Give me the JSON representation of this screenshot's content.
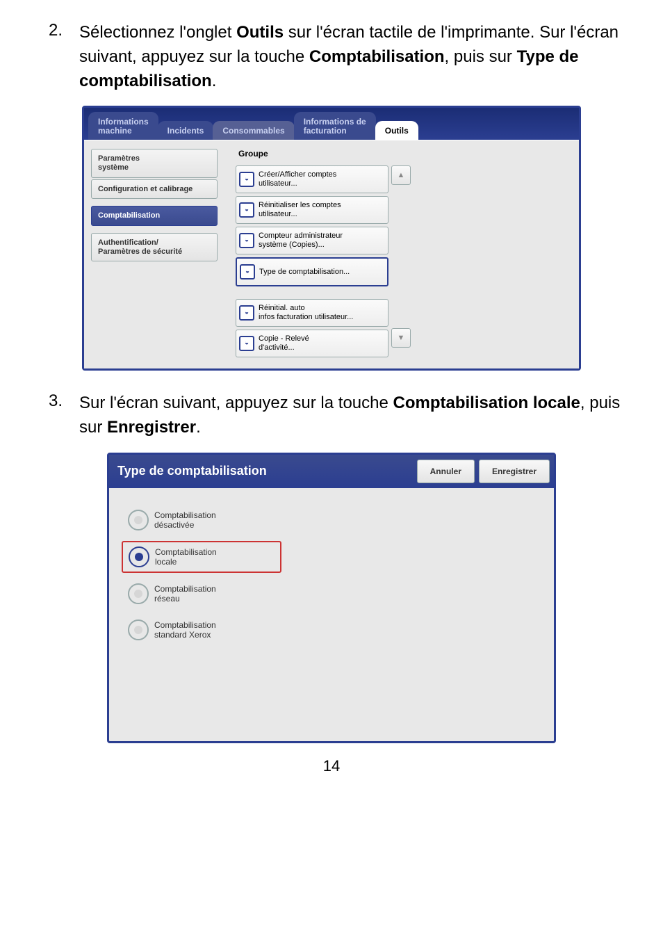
{
  "step2_num": "2.",
  "step2_pre": "Sélectionnez l'onglet ",
  "step2_b1": "Outils",
  "step2_mid1": " sur l'écran tactile de l'imprimante. Sur l'écran suivant, appuyez sur la touche ",
  "step2_b2": "Comptabilisation",
  "step2_mid2": ", puis sur ",
  "step2_b3": "Type de comptabilisation",
  "step2_end": ".",
  "tabs": {
    "t1": "Informations\nmachine",
    "t2": "Incidents",
    "t3": "Consommables",
    "t4": "Informations de\nfacturation",
    "t5": "Outils"
  },
  "side": {
    "s1": "Paramètres\nsystème",
    "s2": "Configuration et calibrage",
    "s3": "Comptabilisation",
    "s4": "Authentification/\nParamètres de sécurité"
  },
  "group_label": "Groupe",
  "list": {
    "i1": "Créer/Afficher comptes\nutilisateur...",
    "i2": "Réinitialiser les comptes\nutilisateur...",
    "i3": "Compteur administrateur\nsystème (Copies)...",
    "i4": "Type de comptabilisation...",
    "i5": "Réinitial. auto\ninfos facturation utilisateur...",
    "i6": "Copie - Relevé\nd'activité..."
  },
  "step3_num": "3.",
  "step3_pre": "Sur l'écran suivant, appuyez sur la touche ",
  "step3_b1": "Comptabilisation locale",
  "step3_mid": ", puis sur ",
  "step3_b2": "Enregistrer",
  "step3_end": ".",
  "p2": {
    "title": "Type de comptabilisation",
    "cancel": "Annuler",
    "save": "Enregistrer",
    "o1": "Comptabilisation\ndésactivée",
    "o2": "Comptabilisation\nlocale",
    "o3": "Comptabilisation\nréseau",
    "o4": "Comptabilisation\nstandard Xerox"
  },
  "pagenum": "14"
}
